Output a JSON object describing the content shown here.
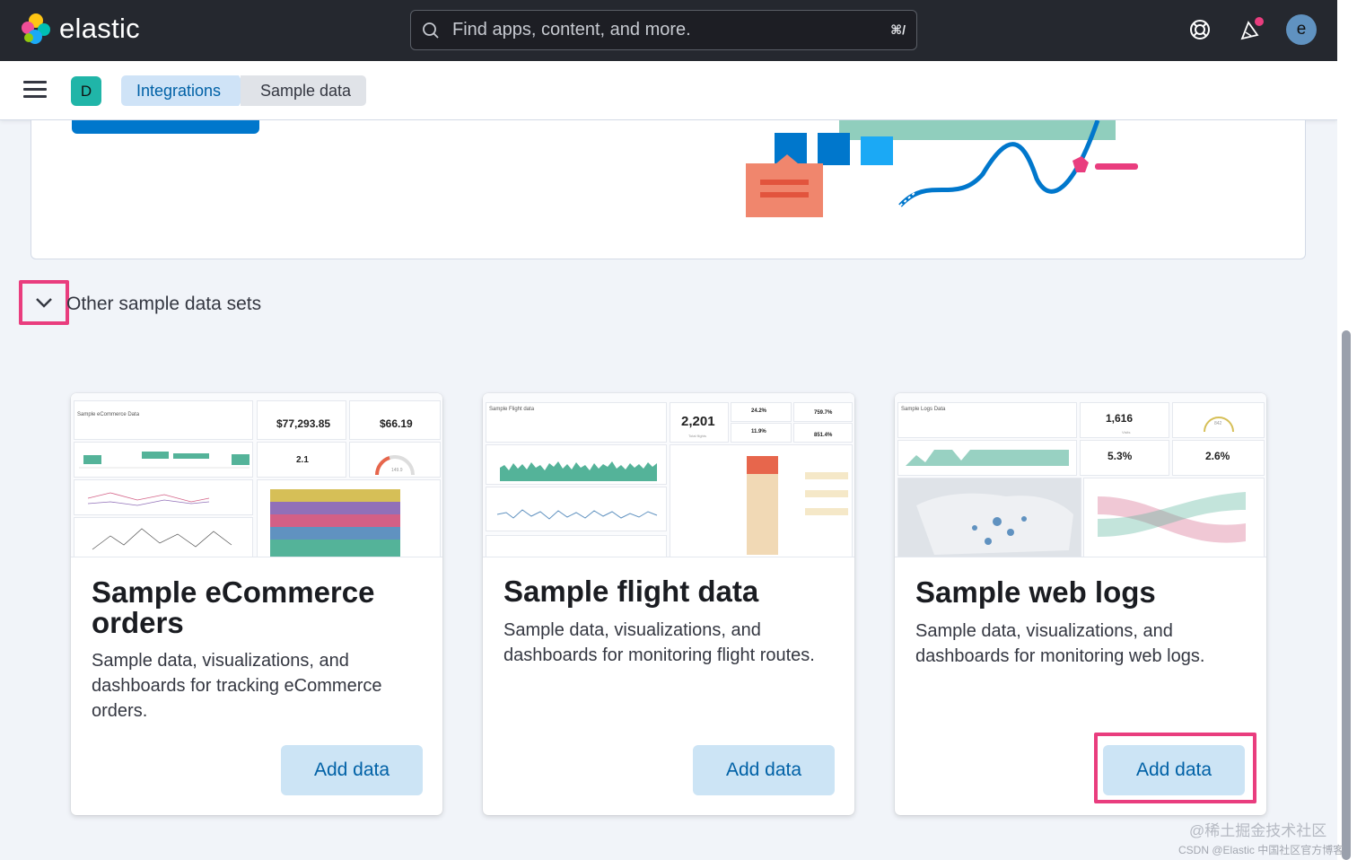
{
  "header": {
    "logo_text": "elastic",
    "search_placeholder": "Find apps, content, and more.",
    "search_shortcut": "⌘/",
    "avatar_initial": "e"
  },
  "subnav": {
    "space_initial": "D",
    "breadcrumbs": [
      "Integrations",
      "Sample data"
    ]
  },
  "section": {
    "title": "Other sample data sets"
  },
  "cards": [
    {
      "title": "Sample eCommerce orders",
      "description": "Sample data, visualizations, and dashboards for tracking eCommerce orders.",
      "button": "Add data",
      "thumb": {
        "header": "Sample eCommerce Data",
        "kpi1": "$77,293.85",
        "kpi2": "$66.19",
        "kpi3": "2.1",
        "gauge": "149.9"
      }
    },
    {
      "title": "Sample flight data",
      "description": "Sample data, visualizations, and dashboards for monitoring flight routes.",
      "button": "Add data",
      "thumb": {
        "header": "Sample Flight data",
        "kpi1": "2,201",
        "kpi1_sub": "Total flights",
        "kpi2": "24.2%",
        "kpi3": "759.7%",
        "kpi4": "11.9%",
        "kpi5": "851.4%"
      }
    },
    {
      "title": "Sample web logs",
      "description": "Sample data, visualizations, and dashboards for monitoring web logs.",
      "button": "Add data",
      "thumb": {
        "header": "Sample Logs Data",
        "kpi1": "1,616",
        "kpi1_sub": "Visits",
        "gauge": "842",
        "kpi2": "5.3%",
        "kpi3": "2.6%"
      }
    }
  ],
  "watermark": {
    "line1": "@稀土掘金技术社区",
    "line2": "CSDN @Elastic 中国社区官方博客"
  },
  "colors": {
    "topbar": "#25282f",
    "primary": "#0077cc",
    "highlight": "#e93d7e",
    "button_bg": "#cce4f5",
    "button_text": "#0061a6"
  }
}
